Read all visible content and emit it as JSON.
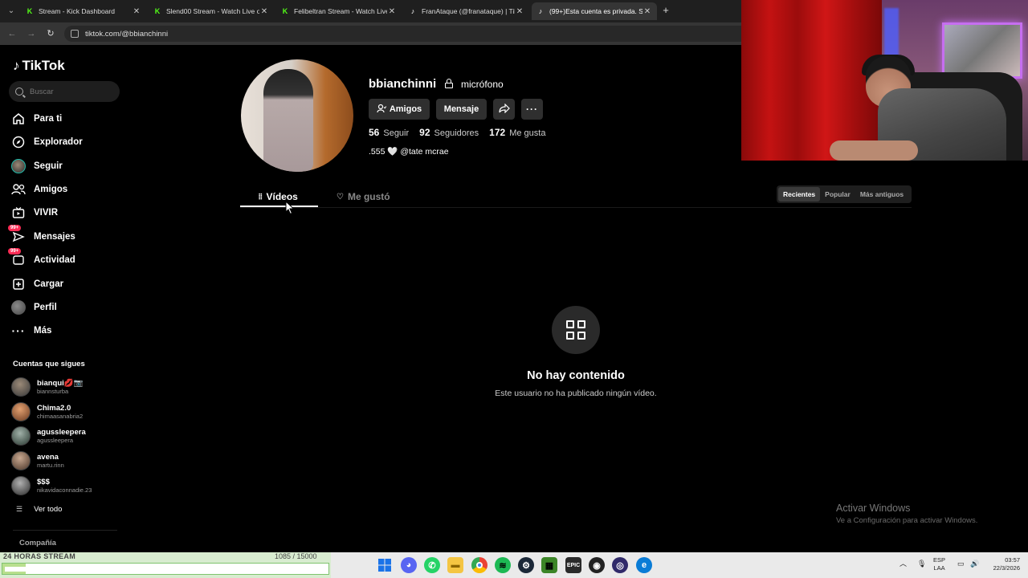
{
  "browser": {
    "tabs": [
      {
        "title": "Stream - Kick Dashboard",
        "icon": "kick-icon"
      },
      {
        "title": "Slend00 Stream - Watch Live on",
        "icon": "kick-icon"
      },
      {
        "title": "Felibeltran Stream - Watch Live",
        "icon": "kick-icon"
      },
      {
        "title": "FranAtaque (@franataque) | Tik",
        "icon": "tiktok-icon"
      },
      {
        "title": "(99+)Esta cuenta es privada. Sig",
        "icon": "tiktok-icon",
        "active": true
      }
    ],
    "url": "tiktok.com/@bbianchinni"
  },
  "sidebar": {
    "logo": "TikTok",
    "search_placeholder": "Buscar",
    "nav": [
      {
        "label": "Para ti",
        "icon": "home-icon"
      },
      {
        "label": "Explorador",
        "icon": "compass-icon"
      },
      {
        "label": "Seguir",
        "icon": "following-avatar-icon"
      },
      {
        "label": "Amigos",
        "icon": "friends-icon"
      },
      {
        "label": "VIVIR",
        "icon": "live-tv-icon"
      },
      {
        "label": "Mensajes",
        "icon": "messages-icon",
        "badge": "99+"
      },
      {
        "label": "Actividad",
        "icon": "activity-icon",
        "badge": "99+"
      },
      {
        "label": "Cargar",
        "icon": "upload-icon"
      },
      {
        "label": "Perfil",
        "icon": "profile-avatar-icon"
      },
      {
        "label": "Más",
        "icon": "more-icon"
      }
    ],
    "following_title": "Cuentas que sigues",
    "following": [
      {
        "name": "bianqui💋📷",
        "handle": "biannsturba"
      },
      {
        "name": "Chima2.0",
        "handle": "chimaasanabria2"
      },
      {
        "name": "agussleepera",
        "handle": "agussleepera"
      },
      {
        "name": "avena",
        "handle": "martu.rinn"
      },
      {
        "name": "$$$",
        "handle": "nikavidaconnadie.23"
      }
    ],
    "see_all": "Ver todo",
    "company": "Compañía"
  },
  "profile": {
    "username": "bbianchinni",
    "nickname": "micrófono",
    "buttons": {
      "friends": "Amigos",
      "message": "Mensaje"
    },
    "stats": {
      "following_count": "56",
      "following_label": "Seguir",
      "followers_count": "92",
      "followers_label": "Seguidores",
      "likes_count": "172",
      "likes_label": "Me gusta"
    },
    "bio": ".555 🤍 @tate mcrae",
    "tabs": {
      "videos": "Vídeos",
      "liked": "Me gustó"
    },
    "sort": {
      "recent": "Recientes",
      "popular": "Popular",
      "oldest": "Más antiguos"
    },
    "empty_title": "No hay contenido",
    "empty_subtitle": "Este usuario no ha publicado ningún vídeo."
  },
  "watermark": {
    "title": "Activar Windows",
    "subtitle": "Ve a Configuración para activar Windows."
  },
  "stream_overlay": {
    "label": "24 HORAS STREAM",
    "count": "1085 / 15000",
    "progress": 0.072
  },
  "taskbar": {
    "lang_top": "ESP",
    "lang_bottom": "LAA",
    "time": "03:57",
    "date": "22/3/2026"
  },
  "colors": {
    "accent": "#fe2c55",
    "kick": "#53fc18"
  }
}
